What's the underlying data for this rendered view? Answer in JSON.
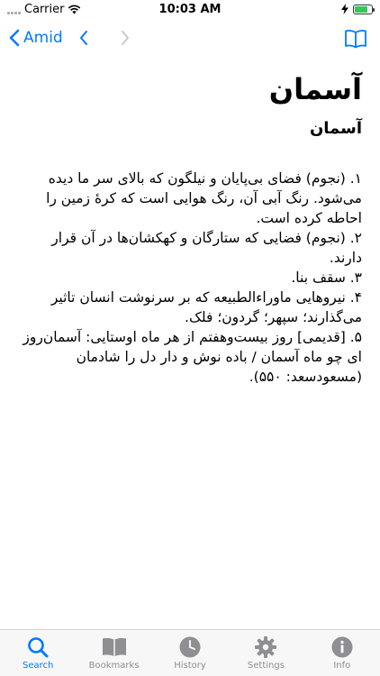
{
  "status_bar": {
    "carrier": "Carrier",
    "time": "10:03 AM",
    "battery_level": 0.8
  },
  "nav": {
    "back_label": "Amid",
    "back_icon": "chevron-left-icon",
    "prev_icon": "chevron-left-icon",
    "next_icon": "chevron-right-icon",
    "book_icon": "book-icon",
    "accent_color": "#007aff"
  },
  "entry": {
    "headword": "آسمان",
    "title": "آسمان",
    "definitions": [
      "۱. (نجوم) فضای بی‌پایان و نیلگون که بالای سر ما دیده می‌شود. رنگ آبی آن، رنگ هوایی است که کرهٔ زمین را احاطه کرده است.",
      "۲. (نجوم) فضایی که ستارگان و کهکشان‌ها در آن قرار دارند.",
      "۳. سقف بنا.",
      "۴. نیروهایی ماوراءالطبیعه که بر سرنوشت انسان تاثیر می‌گذارند؛ سپهر؛ گردون؛ فلک.",
      "۵. [قدیمی] روز بیست‌وهفتم از هر ماه اوستایی: آسمان‌روز ای چو ماه آسمان / باده نوش و دار دل را شادمان (مسعودسعد: ۵۵۰)."
    ]
  },
  "tabs": [
    {
      "label": "Search",
      "icon": "search-icon",
      "active": true
    },
    {
      "label": "Bookmarks",
      "icon": "bookmarks-icon",
      "active": false
    },
    {
      "label": "History",
      "icon": "history-icon",
      "active": false
    },
    {
      "label": "Settings",
      "icon": "settings-icon",
      "active": false
    },
    {
      "label": "Info",
      "icon": "info-icon",
      "active": false
    }
  ]
}
